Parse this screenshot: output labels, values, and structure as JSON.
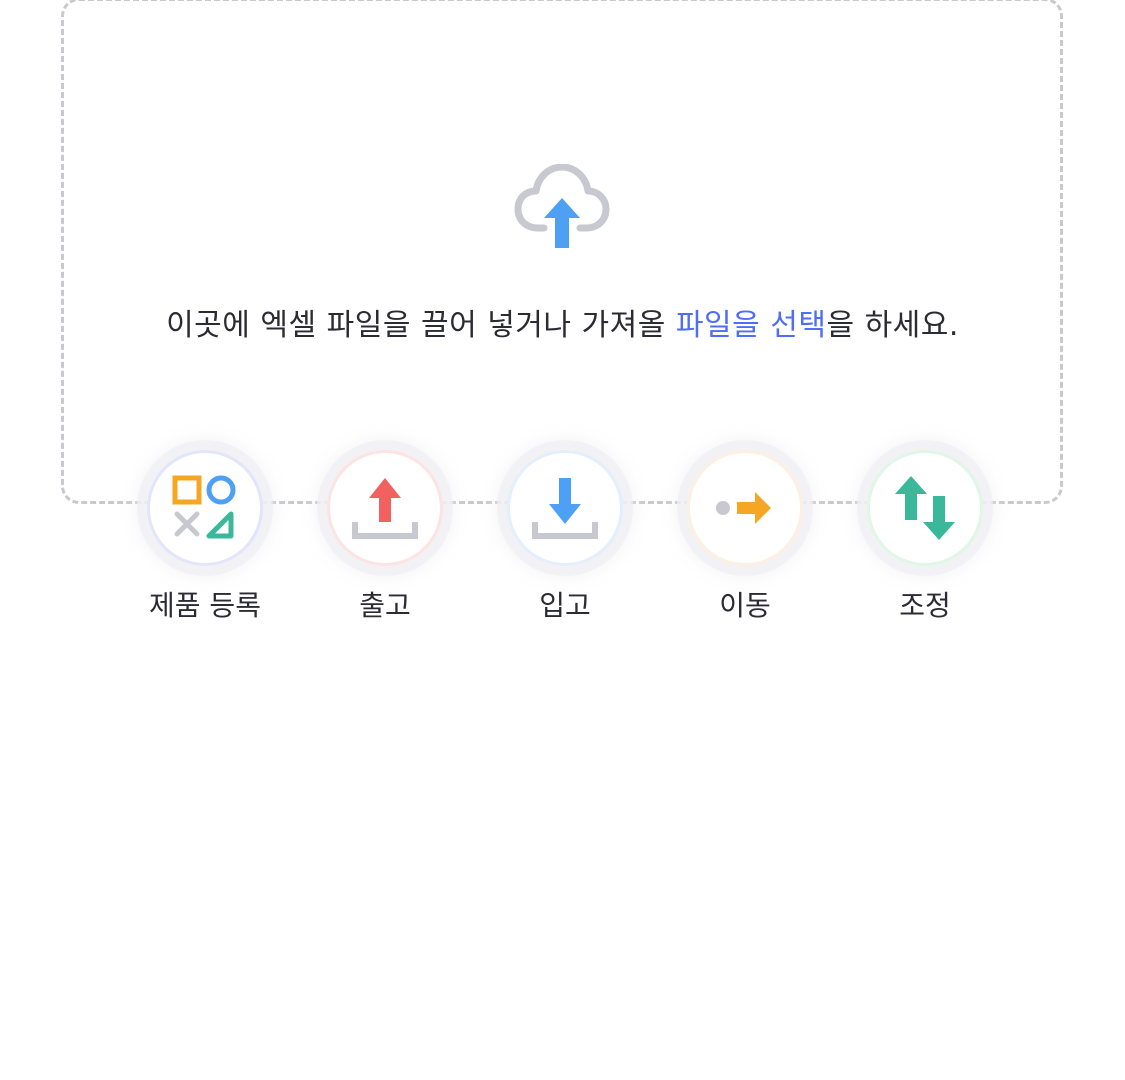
{
  "dropzone": {
    "text_before": "이곳에 엑셀 파일을 끌어 넣거나 가져올 ",
    "link_text": "파일을 선택",
    "text_after": "을 하세요.",
    "icon": "cloud-upload-icon"
  },
  "actions": [
    {
      "label": "제품 등록",
      "icon": "shapes-icon",
      "ring_color": "#e2e5fb"
    },
    {
      "label": "출고",
      "icon": "upload-arrow-icon",
      "ring_color": "#fde3e3"
    },
    {
      "label": "입고",
      "icon": "download-arrow-icon",
      "ring_color": "#e5eefc"
    },
    {
      "label": "이동",
      "icon": "move-arrow-icon",
      "ring_color": "#fdf0e2"
    },
    {
      "label": "조정",
      "icon": "adjust-arrows-icon",
      "ring_color": "#e0f6e6"
    }
  ],
  "colors": {
    "link": "#4f6df5",
    "blue": "#4ea0f5",
    "red": "#f26060",
    "orange": "#f5a623",
    "green": "#3bb89a",
    "gray": "#c8c8d0"
  }
}
